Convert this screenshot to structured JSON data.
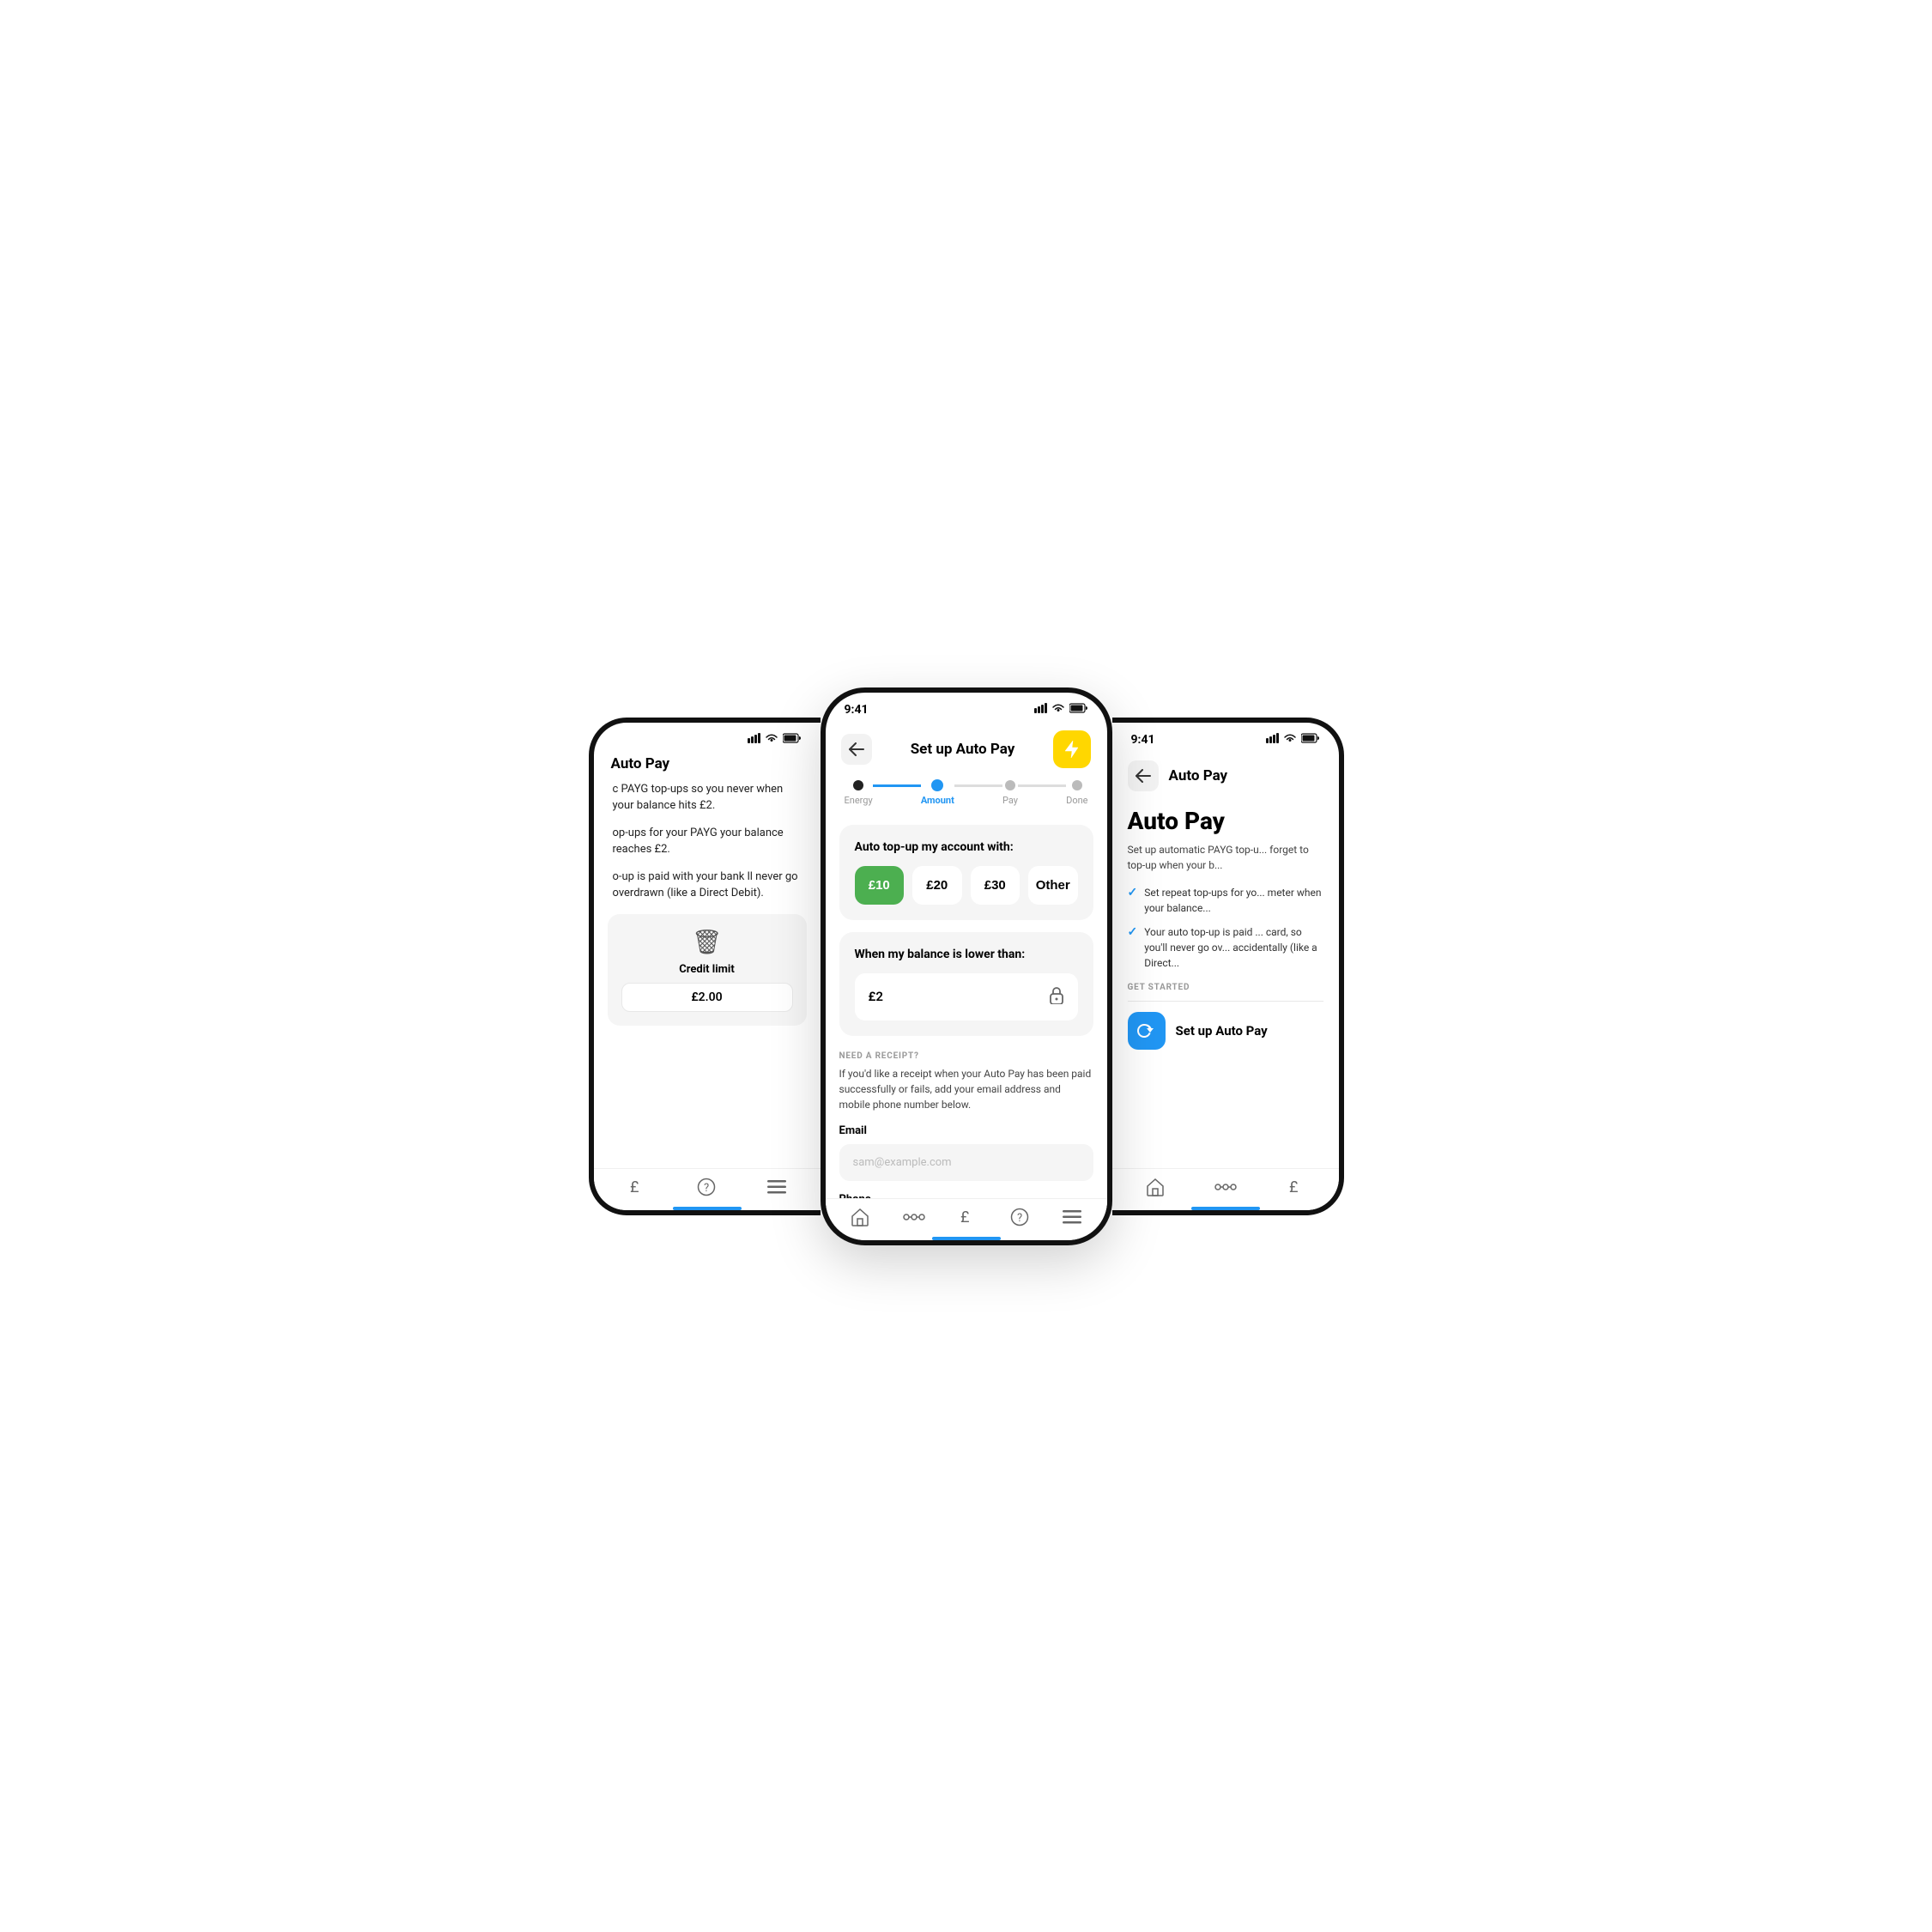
{
  "left": {
    "status": {
      "time": "",
      "signal": "▌▌▌",
      "wifi": "◈",
      "battery": "▬"
    },
    "title": "Auto Pay",
    "body1": "c PAYG top-ups so you never when your balance hits £2.",
    "body2": "op-ups for your PAYG your balance reaches £2.",
    "body3": "o-up is paid with your bank ll never go overdrawn (like a Direct Debit).",
    "card": {
      "trash_icon": "🗑",
      "credit_label": "Credit limit",
      "credit_value": "£2.00"
    },
    "nav": {
      "icons": [
        "£",
        "?",
        "≡"
      ]
    }
  },
  "center": {
    "status": {
      "time": "9:41",
      "signal": "▌▌▌",
      "wifi": "◈",
      "battery": "▬"
    },
    "header": {
      "back_label": "←",
      "title": "Set up Auto Pay",
      "bolt": "⚡"
    },
    "steps": [
      {
        "label": "Energy",
        "state": "done"
      },
      {
        "label": "Amount",
        "state": "active"
      },
      {
        "label": "Pay",
        "state": "inactive"
      },
      {
        "label": "Done",
        "state": "inactive"
      }
    ],
    "top_up_card": {
      "title": "Auto top-up my account with:",
      "options": [
        {
          "label": "£10",
          "selected": true
        },
        {
          "label": "£20",
          "selected": false
        },
        {
          "label": "£30",
          "selected": false
        },
        {
          "label": "Other",
          "selected": false
        }
      ]
    },
    "balance_card": {
      "title": "When my balance is lower than:",
      "value": "£2",
      "lock": "🔒"
    },
    "receipt": {
      "section_label": "NEED A RECEIPT?",
      "description": "If you'd like a receipt when your Auto Pay has been paid successfully or fails, add your email address and mobile phone number below.",
      "email_label": "Email",
      "email_placeholder": "sam@example.com",
      "phone_label": "Phone"
    },
    "nav": {
      "icons": [
        "⌂",
        "⌬",
        "£",
        "?",
        "≡"
      ]
    }
  },
  "right": {
    "status": {
      "time": "9:41",
      "signal": "▌▌▌",
      "wifi": "◈",
      "battery": "▬"
    },
    "header": {
      "back_label": "←",
      "title": "Auto Pay"
    },
    "title": "Auto Pay",
    "description": "Set up automatic PAYG top-u... forget to top-up when your b...",
    "checks": [
      "Set repeat top-ups for yo... meter when your balance...",
      "Your auto top-up is paid ... card, so you'll never go ov... accidentally (like a Direct..."
    ],
    "get_started_label": "GET STARTED",
    "cta_label": "Set up Auto Pay",
    "nav": {
      "icons": [
        "⌂",
        "⌬",
        "£"
      ]
    }
  }
}
